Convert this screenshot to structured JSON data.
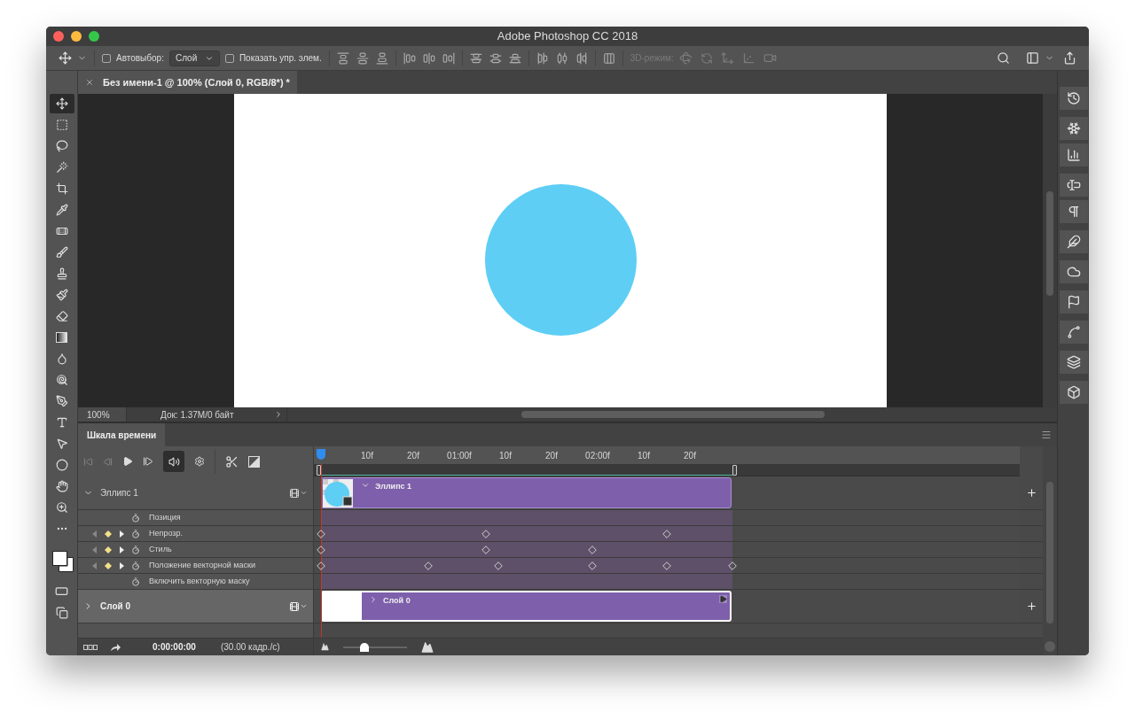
{
  "window": {
    "title": "Adobe Photoshop CC 2018"
  },
  "options_bar": {
    "auto_select": {
      "label": "Автовыбор:",
      "checked": false
    },
    "auto_select_target": {
      "value": "Слой"
    },
    "show_controls": {
      "label": "Показать упр. элем.",
      "checked": false
    },
    "mode_3d": {
      "label": "3D-режим:",
      "disabled": true
    }
  },
  "tools": [
    {
      "selected": true
    },
    {
      "selected": false
    },
    {
      "selected": false
    },
    {
      "selected": false
    },
    {
      "selected": false
    },
    {
      "selected": false
    },
    {
      "selected": false
    },
    {
      "selected": false
    },
    {
      "selected": false
    },
    {
      "selected": false
    },
    {
      "selected": false
    },
    {
      "selected": false
    },
    {
      "selected": false
    },
    {
      "selected": false
    },
    {
      "selected": false
    },
    {
      "selected": false
    },
    {
      "selected": false
    },
    {
      "selected": false
    },
    {
      "selected": false
    },
    {
      "selected": false
    },
    {
      "selected": false
    }
  ],
  "document_tab": {
    "title": "Без имени-1 @ 100% (Слой 0, RGB/8*) *"
  },
  "status_bar": {
    "zoom": "100%",
    "doc_info": "Док: 1.37M/0 байт"
  },
  "timeline": {
    "tab": "Шкала времени",
    "audio": {
      "selected": true
    },
    "ruler": [
      "10f",
      "20f",
      "01:00f",
      "10f",
      "20f",
      "02:00f",
      "10f",
      "20f"
    ],
    "layers": [
      {
        "name": "Эллипс 1",
        "kind": "shape",
        "expanded": true,
        "selected": false,
        "clip_label": "Эллипс 1",
        "properties": [
          {
            "name": "Позиция",
            "animated": false
          },
          {
            "name": "Непрозр.",
            "animated": true,
            "keyframes": [
              {
                "level": 0
              },
              {
                "level": 0.4
              },
              {
                "level": 0.84
              }
            ]
          },
          {
            "name": "Стиль",
            "animated": true,
            "keyframes": [
              {
                "level": 0
              },
              {
                "level": 0.4
              },
              {
                "level": 0.66
              }
            ]
          },
          {
            "name": "Положение векторной маски",
            "animated": true,
            "keyframes": [
              {
                "level": 0
              },
              {
                "level": 0.26
              },
              {
                "level": 0.43
              },
              {
                "level": 0.66
              },
              {
                "level": 0.84
              },
              {
                "level": 1
              }
            ]
          },
          {
            "name": "Включить векторную маску",
            "animated": false
          }
        ]
      },
      {
        "name": "Слой 0",
        "kind": "pixel",
        "expanded": false,
        "selected": true,
        "clip_label": "Слой 0"
      }
    ],
    "timecode": "0:00:00:00",
    "frame_rate": "(30.00 кадр./с)",
    "zoom": {
      "level": 0.34
    }
  }
}
